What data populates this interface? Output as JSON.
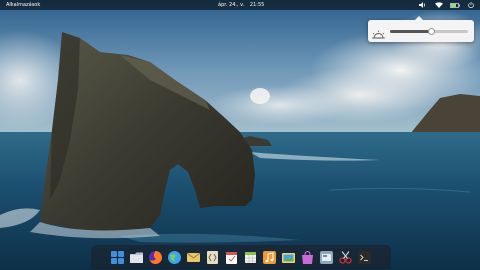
{
  "panel": {
    "applications_label": "Alkalmazások",
    "date": "ápr. 24., v.",
    "time": "21:55"
  },
  "indicators": [
    "speaker-icon",
    "network-icon",
    "battery-icon",
    "power-icon"
  ],
  "brightness_popover": {
    "icon": "brightness-icon",
    "level": 0.52
  },
  "dock": {
    "items": [
      {
        "name": "multitasking-view-icon",
        "color": "#3f8fdc"
      },
      {
        "name": "files-icon",
        "color": "#b8c2cc"
      },
      {
        "name": "firefox-icon",
        "color": "#ff7b24"
      },
      {
        "name": "web-browser-icon",
        "color": "#3aa6e8"
      },
      {
        "name": "mail-icon",
        "color": "#e9c86b"
      },
      {
        "name": "code-editor-icon",
        "color": "#e6dcc5"
      },
      {
        "name": "calendar-icon",
        "color": "#ffffff"
      },
      {
        "name": "spreadsheet-icon",
        "color": "#8ac34a"
      },
      {
        "name": "music-icon",
        "color": "#f19733"
      },
      {
        "name": "photos-icon",
        "color": "#4aa3df"
      },
      {
        "name": "app-center-icon",
        "color": "#c76bd6"
      },
      {
        "name": "system-settings-icon",
        "color": "#8fa7bd"
      },
      {
        "name": "screenshot-icon",
        "color": "#d9d9d9"
      },
      {
        "name": "terminal-icon",
        "color": "#2b2b2b"
      }
    ]
  }
}
